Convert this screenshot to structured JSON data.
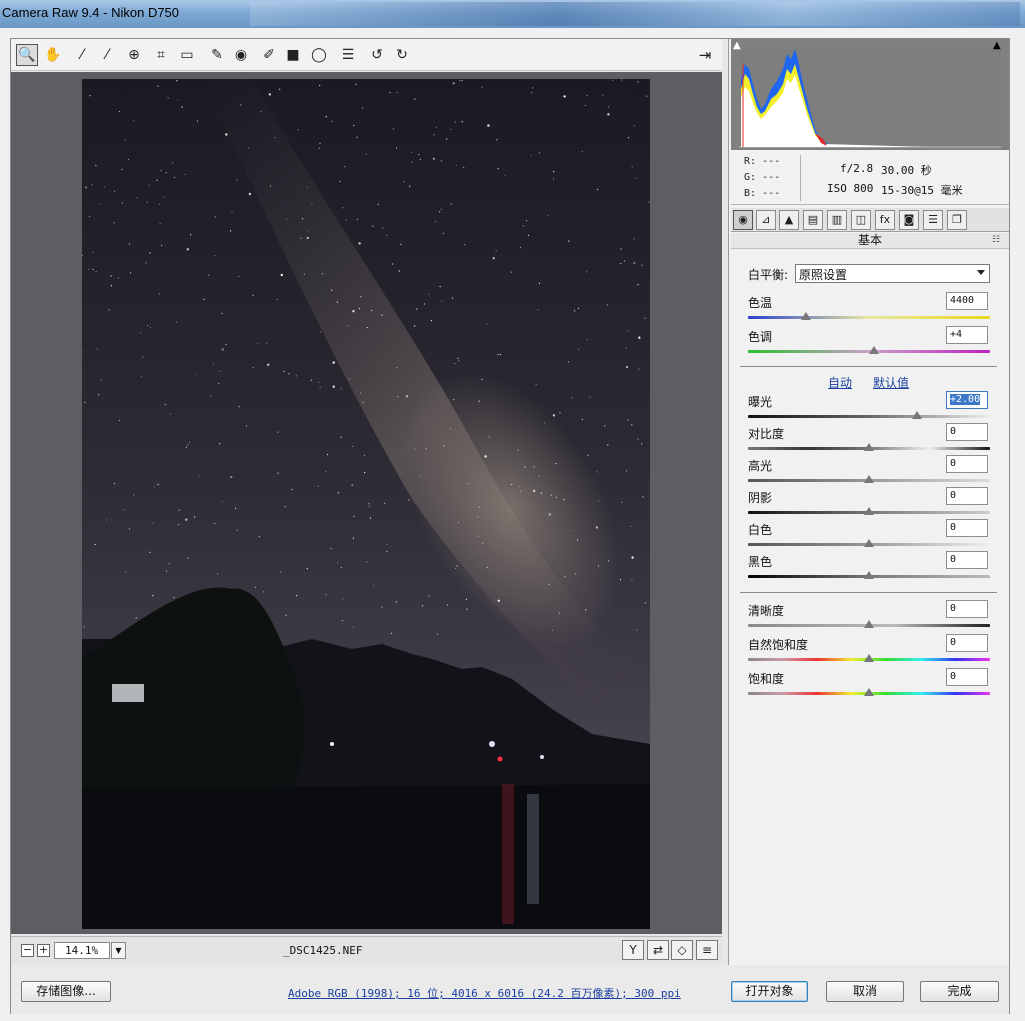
{
  "window": {
    "title": "Camera Raw 9.4 -  Nikon D750"
  },
  "toolbar": {
    "tools": [
      {
        "name": "zoom-tool",
        "glyph": "🔍"
      },
      {
        "name": "hand-tool",
        "glyph": "✋"
      },
      {
        "name": "white-balance-tool",
        "glyph": "⁄"
      },
      {
        "name": "color-sampler-tool",
        "glyph": "⁄"
      },
      {
        "name": "targeted-adjustment-tool",
        "glyph": "⊕"
      },
      {
        "name": "crop-tool",
        "glyph": "⌗"
      },
      {
        "name": "straighten-tool",
        "glyph": "▭"
      },
      {
        "name": "spot-removal-tool",
        "glyph": "✎"
      },
      {
        "name": "red-eye-tool",
        "glyph": "◉"
      },
      {
        "name": "adjustment-brush-tool",
        "glyph": "✐"
      },
      {
        "name": "graduated-filter-tool",
        "glyph": "■"
      },
      {
        "name": "radial-filter-tool",
        "glyph": "◯"
      },
      {
        "name": "preferences-tool",
        "glyph": "☰"
      },
      {
        "name": "rotate-left-tool",
        "glyph": "↺"
      },
      {
        "name": "rotate-right-tool",
        "glyph": "↻"
      }
    ]
  },
  "canvas": {
    "zoom_minus": "−",
    "zoom_plus": "+",
    "zoom_value": "14.1%",
    "filename": "_DSC1425.NEF"
  },
  "info": {
    "r_label": "R:",
    "r_value": "---",
    "g_label": "G:",
    "g_value": "---",
    "b_label": "B:",
    "b_value": "---",
    "aperture": "f/2.8",
    "shutter": "30.00 秒",
    "iso": "ISO 800",
    "lens": "15-30@15 毫米"
  },
  "panel": {
    "section_title": "基本",
    "white_balance_label": "白平衡:",
    "white_balance_value": "原照设置",
    "auto_link": "自动",
    "default_link": "默认值",
    "sliders": {
      "temperature": {
        "label": "色温",
        "value": "4400",
        "position": 0.24
      },
      "tint": {
        "label": "色调",
        "value": "+4",
        "position": 0.52
      },
      "exposure": {
        "label": "曝光",
        "value": "+2.00",
        "position": 0.7
      },
      "contrast": {
        "label": "对比度",
        "value": "0",
        "position": 0.5
      },
      "highlights": {
        "label": "高光",
        "value": "0",
        "position": 0.5
      },
      "shadows": {
        "label": "阴影",
        "value": "0",
        "position": 0.5
      },
      "whites": {
        "label": "白色",
        "value": "0",
        "position": 0.5
      },
      "blacks": {
        "label": "黑色",
        "value": "0",
        "position": 0.5
      },
      "clarity": {
        "label": "清晰度",
        "value": "0",
        "position": 0.5
      },
      "vibrance": {
        "label": "自然饱和度",
        "value": "0",
        "position": 0.5
      },
      "saturation": {
        "label": "饱和度",
        "value": "0",
        "position": 0.5
      }
    }
  },
  "footer": {
    "save_image": "存储图像...",
    "workflow": "Adobe RGB (1998); 16 位; 4016 x 6016 (24.2 百万像素); 300 ppi",
    "open_object": "打开对象",
    "cancel": "取消",
    "done": "完成"
  }
}
